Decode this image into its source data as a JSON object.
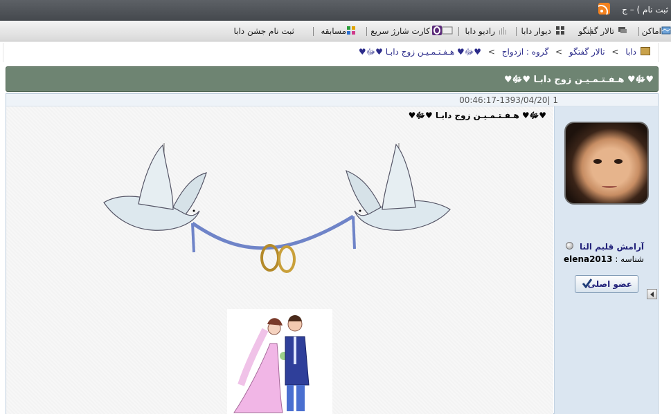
{
  "topbar": {
    "register_text": "ثبت نام )  –  ج",
    "rss_icon": "rss-icon"
  },
  "nav": {
    "items": [
      {
        "label": "اماکن",
        "icon": "map-icon"
      },
      {
        "label": "تالار گفتگو",
        "icon": "chat-icon"
      },
      {
        "label": "دیوار دابا",
        "icon": "wall-icon"
      },
      {
        "label": "رادیو دابا",
        "icon": "radio-icon"
      },
      {
        "label": "کارت شارژ سریع",
        "icon": "charge-card-icon"
      },
      {
        "label": "مسابقه",
        "icon": "contest-icon"
      },
      {
        "label": "ثبت نام جشن دابا"
      }
    ]
  },
  "breadcrumb": {
    "items": [
      "دابا",
      "تالار گفتگو",
      "گروه : ازدواج",
      "♥ﷻ♥ هـفـتـمـیـن زوج دابـا ♥ﷻ♥"
    ],
    "separator": ">"
  },
  "topic": {
    "title": "♥ﷻ♥ هـفـتـمـیـن زوج دابـا ♥ﷻ♥"
  },
  "post": {
    "number": "1",
    "date": "00:46:17-1393/04/20",
    "title": "♥ﷻ♥ هـفـتـمـیـن زوج دابـا ♥ﷻ♥"
  },
  "author": {
    "name": "آرامش قلبم النا",
    "id_label": "شناسه :",
    "id_value": "elena2013",
    "rank": "عضو اصلی"
  },
  "colors": {
    "title_bar": "#6e8472",
    "sidebar": "#dbe6f1",
    "link": "#22227a"
  }
}
